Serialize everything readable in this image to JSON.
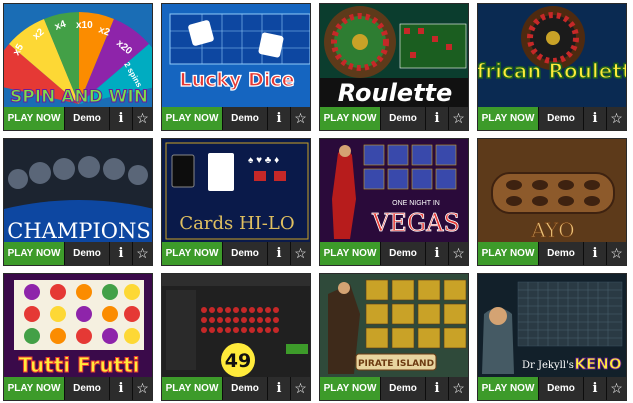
{
  "buttons": {
    "play_label": "PLAY NOW",
    "demo_label": "Demo",
    "info_label": "i",
    "fav_label": "☆"
  },
  "games": [
    {
      "title": "SPIN AND WIN",
      "wheel_labels": [
        "x5",
        "x2",
        "x4",
        "x10",
        "x2",
        "x20",
        "2 spins"
      ]
    },
    {
      "title": "Lucky Dice"
    },
    {
      "title": "Roulette"
    },
    {
      "title": "African Roulette"
    },
    {
      "title": "CHAMPIONS"
    },
    {
      "title": "Cards HI-LO"
    },
    {
      "title": "VEGAS",
      "subtitle": "ONE NIGHT IN"
    },
    {
      "title": "AYO"
    },
    {
      "title": "Tutti Frutti"
    },
    {
      "title": "49"
    },
    {
      "title": "PIRATE ISLAND"
    },
    {
      "title": "KENO",
      "prefix": "Dr Jekyll's"
    }
  ]
}
